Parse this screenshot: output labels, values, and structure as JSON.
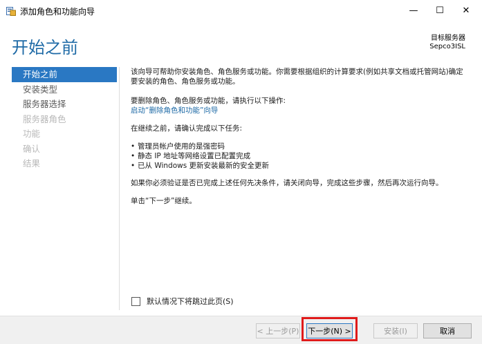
{
  "window": {
    "title": "添加角色和功能向导",
    "minimize_glyph": "—",
    "maximize_glyph": "☐",
    "close_glyph": "✕"
  },
  "header": {
    "page_title": "开始之前",
    "target_label": "目标服务器",
    "target_name": "Sepco3ISL"
  },
  "nav": {
    "items": [
      {
        "label": "开始之前",
        "state": "active"
      },
      {
        "label": "安装类型",
        "state": "normal"
      },
      {
        "label": "服务器选择",
        "state": "normal"
      },
      {
        "label": "服务器角色",
        "state": "disabled"
      },
      {
        "label": "功能",
        "state": "disabled"
      },
      {
        "label": "确认",
        "state": "disabled"
      },
      {
        "label": "结果",
        "state": "disabled"
      }
    ]
  },
  "content": {
    "intro": "该向导可帮助你安装角色、角色服务或功能。你需要根据组织的计算要求(例如共享文档或托管网站)确定要安装的角色、角色服务或功能。",
    "remove_text": "要删除角色、角色服务或功能，请执行以下操作:",
    "remove_link": "启动“删除角色和功能”向导",
    "tasks_intro": "在继续之前，请确认完成以下任务:",
    "tasks": [
      "管理员帐户使用的是强密码",
      "静态 IP 地址等网络设置已配置完成",
      "已从 Windows 更新安装最新的安全更新"
    ],
    "verify_text": "如果你必须验证是否已完成上述任何先决条件，请关闭向导，完成这些步骤，然后再次运行向导。",
    "continue_text": "单击“下一步”继续。"
  },
  "skip_checkbox": {
    "label": "默认情况下将跳过此页(S)",
    "checked": false
  },
  "footer": {
    "prev_label": "< 上一步(P)",
    "next_label": "下一步(N) >",
    "install_label": "安装(I)",
    "cancel_label": "取消"
  },
  "colors": {
    "accent": "#2a78c3",
    "title": "#1e6aa6",
    "highlight_box": "#e01a1a"
  }
}
